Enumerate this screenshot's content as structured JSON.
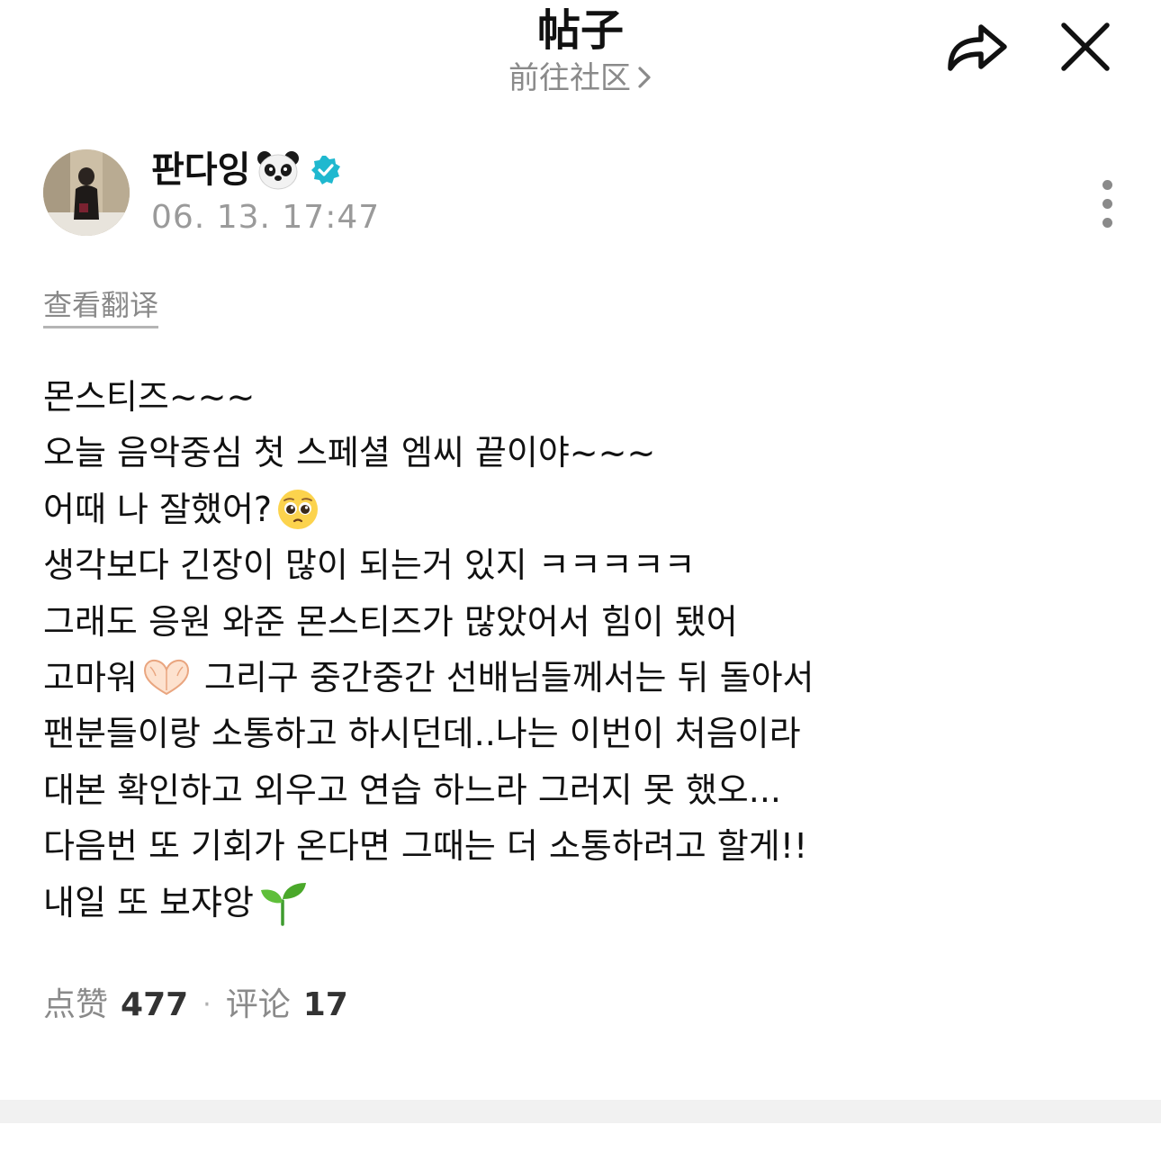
{
  "header": {
    "title": "帖子",
    "community_link": "前往社区",
    "share_icon": "share-arrow-icon",
    "close_icon": "close-icon"
  },
  "author": {
    "name": "판다잉",
    "name_emoji": "panda-face-icon",
    "verified_icon": "verified-badge-icon",
    "verified_color": "#1fb8cf",
    "timestamp": "06. 13. 17:47",
    "more_icon": "more-vertical-icon"
  },
  "translate": {
    "label": "查看翻译"
  },
  "post": {
    "lines": [
      {
        "text": "몬스티즈~~~",
        "emoji": ""
      },
      {
        "text": "오늘 음악중심 첫 스페셜 엠씨 끝이야~~~",
        "emoji": ""
      },
      {
        "text": "어때 나 잘했어?",
        "emoji": "pleading-face-icon"
      },
      {
        "text": "생각보다 긴장이 많이 되는거 있지 ㅋㅋㅋㅋㅋ",
        "emoji": ""
      },
      {
        "text": "그래도 응원 와준 몬스티즈가 많았어서 힘이 됐어",
        "emoji": ""
      },
      {
        "text": "고마워",
        "emoji": "heart-hands-icon",
        "text_after": "그리구 중간중간 선배님들께서는 뒤 돌아서"
      },
      {
        "text": "팬분들이랑 소통하고 하시던데..나는 이번이 처음이라",
        "emoji": ""
      },
      {
        "text": "대본 확인하고 외우고 연습 하느라 그러지 못 했오...",
        "emoji": ""
      },
      {
        "text": "다음번 또 기회가 온다면 그때는 더 소통하려고 할게!!",
        "emoji": ""
      },
      {
        "text": "내일 또 보쟈앙",
        "emoji": "seedling-icon"
      }
    ]
  },
  "stats": {
    "likes_label": "点赞",
    "likes_count": "477",
    "separator": "·",
    "comments_label": "评论",
    "comments_count": "17"
  }
}
